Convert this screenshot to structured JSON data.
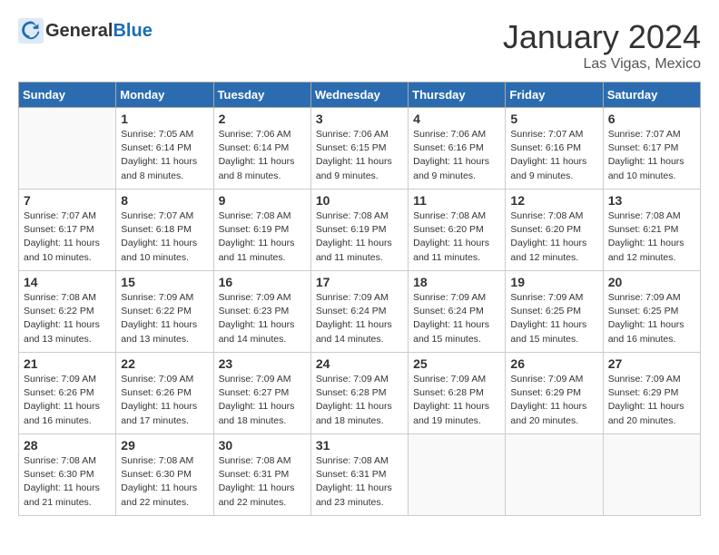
{
  "header": {
    "logo_general": "General",
    "logo_blue": "Blue",
    "month_title": "January 2024",
    "location": "Las Vigas, Mexico"
  },
  "days_of_week": [
    "Sunday",
    "Monday",
    "Tuesday",
    "Wednesday",
    "Thursday",
    "Friday",
    "Saturday"
  ],
  "weeks": [
    [
      {
        "day": "",
        "info": ""
      },
      {
        "day": "1",
        "info": "Sunrise: 7:05 AM\nSunset: 6:14 PM\nDaylight: 11 hours\nand 8 minutes."
      },
      {
        "day": "2",
        "info": "Sunrise: 7:06 AM\nSunset: 6:14 PM\nDaylight: 11 hours\nand 8 minutes."
      },
      {
        "day": "3",
        "info": "Sunrise: 7:06 AM\nSunset: 6:15 PM\nDaylight: 11 hours\nand 9 minutes."
      },
      {
        "day": "4",
        "info": "Sunrise: 7:06 AM\nSunset: 6:16 PM\nDaylight: 11 hours\nand 9 minutes."
      },
      {
        "day": "5",
        "info": "Sunrise: 7:07 AM\nSunset: 6:16 PM\nDaylight: 11 hours\nand 9 minutes."
      },
      {
        "day": "6",
        "info": "Sunrise: 7:07 AM\nSunset: 6:17 PM\nDaylight: 11 hours\nand 10 minutes."
      }
    ],
    [
      {
        "day": "7",
        "info": ""
      },
      {
        "day": "8",
        "info": "Sunrise: 7:07 AM\nSunset: 6:18 PM\nDaylight: 11 hours\nand 10 minutes."
      },
      {
        "day": "9",
        "info": "Sunrise: 7:08 AM\nSunset: 6:19 PM\nDaylight: 11 hours\nand 11 minutes."
      },
      {
        "day": "10",
        "info": "Sunrise: 7:08 AM\nSunset: 6:19 PM\nDaylight: 11 hours\nand 11 minutes."
      },
      {
        "day": "11",
        "info": "Sunrise: 7:08 AM\nSunset: 6:20 PM\nDaylight: 11 hours\nand 11 minutes."
      },
      {
        "day": "12",
        "info": "Sunrise: 7:08 AM\nSunset: 6:20 PM\nDaylight: 11 hours\nand 12 minutes."
      },
      {
        "day": "13",
        "info": "Sunrise: 7:08 AM\nSunset: 6:21 PM\nDaylight: 11 hours\nand 12 minutes."
      }
    ],
    [
      {
        "day": "14",
        "info": ""
      },
      {
        "day": "15",
        "info": "Sunrise: 7:09 AM\nSunset: 6:22 PM\nDaylight: 11 hours\nand 13 minutes."
      },
      {
        "day": "16",
        "info": "Sunrise: 7:09 AM\nSunset: 6:23 PM\nDaylight: 11 hours\nand 14 minutes."
      },
      {
        "day": "17",
        "info": "Sunrise: 7:09 AM\nSunset: 6:24 PM\nDaylight: 11 hours\nand 14 minutes."
      },
      {
        "day": "18",
        "info": "Sunrise: 7:09 AM\nSunset: 6:24 PM\nDaylight: 11 hours\nand 15 minutes."
      },
      {
        "day": "19",
        "info": "Sunrise: 7:09 AM\nSunset: 6:25 PM\nDaylight: 11 hours\nand 15 minutes."
      },
      {
        "day": "20",
        "info": "Sunrise: 7:09 AM\nSunset: 6:25 PM\nDaylight: 11 hours\nand 16 minutes."
      }
    ],
    [
      {
        "day": "21",
        "info": ""
      },
      {
        "day": "22",
        "info": "Sunrise: 7:09 AM\nSunset: 6:26 PM\nDaylight: 11 hours\nand 17 minutes."
      },
      {
        "day": "23",
        "info": "Sunrise: 7:09 AM\nSunset: 6:27 PM\nDaylight: 11 hours\nand 18 minutes."
      },
      {
        "day": "24",
        "info": "Sunrise: 7:09 AM\nSunset: 6:28 PM\nDaylight: 11 hours\nand 18 minutes."
      },
      {
        "day": "25",
        "info": "Sunrise: 7:09 AM\nSunset: 6:28 PM\nDaylight: 11 hours\nand 19 minutes."
      },
      {
        "day": "26",
        "info": "Sunrise: 7:09 AM\nSunset: 6:29 PM\nDaylight: 11 hours\nand 20 minutes."
      },
      {
        "day": "27",
        "info": "Sunrise: 7:09 AM\nSunset: 6:29 PM\nDaylight: 11 hours\nand 20 minutes."
      }
    ],
    [
      {
        "day": "28",
        "info": "Sunrise: 7:08 AM\nSunset: 6:30 PM\nDaylight: 11 hours\nand 21 minutes."
      },
      {
        "day": "29",
        "info": "Sunrise: 7:08 AM\nSunset: 6:30 PM\nDaylight: 11 hours\nand 22 minutes."
      },
      {
        "day": "30",
        "info": "Sunrise: 7:08 AM\nSunset: 6:31 PM\nDaylight: 11 hours\nand 22 minutes."
      },
      {
        "day": "31",
        "info": "Sunrise: 7:08 AM\nSunset: 6:31 PM\nDaylight: 11 hours\nand 23 minutes."
      },
      {
        "day": "",
        "info": ""
      },
      {
        "day": "",
        "info": ""
      },
      {
        "day": "",
        "info": ""
      }
    ]
  ],
  "week1_day7_info": "Sunrise: 7:07 AM\nSunset: 6:17 PM\nDaylight: 11 hours\nand 10 minutes.",
  "week2_day14_info": "Sunrise: 7:08 AM\nSunset: 6:22 PM\nDaylight: 11 hours\nand 13 minutes.",
  "week3_day21_info": "Sunrise: 7:09 AM\nSunset: 6:26 PM\nDaylight: 11 hours\nand 16 minutes."
}
